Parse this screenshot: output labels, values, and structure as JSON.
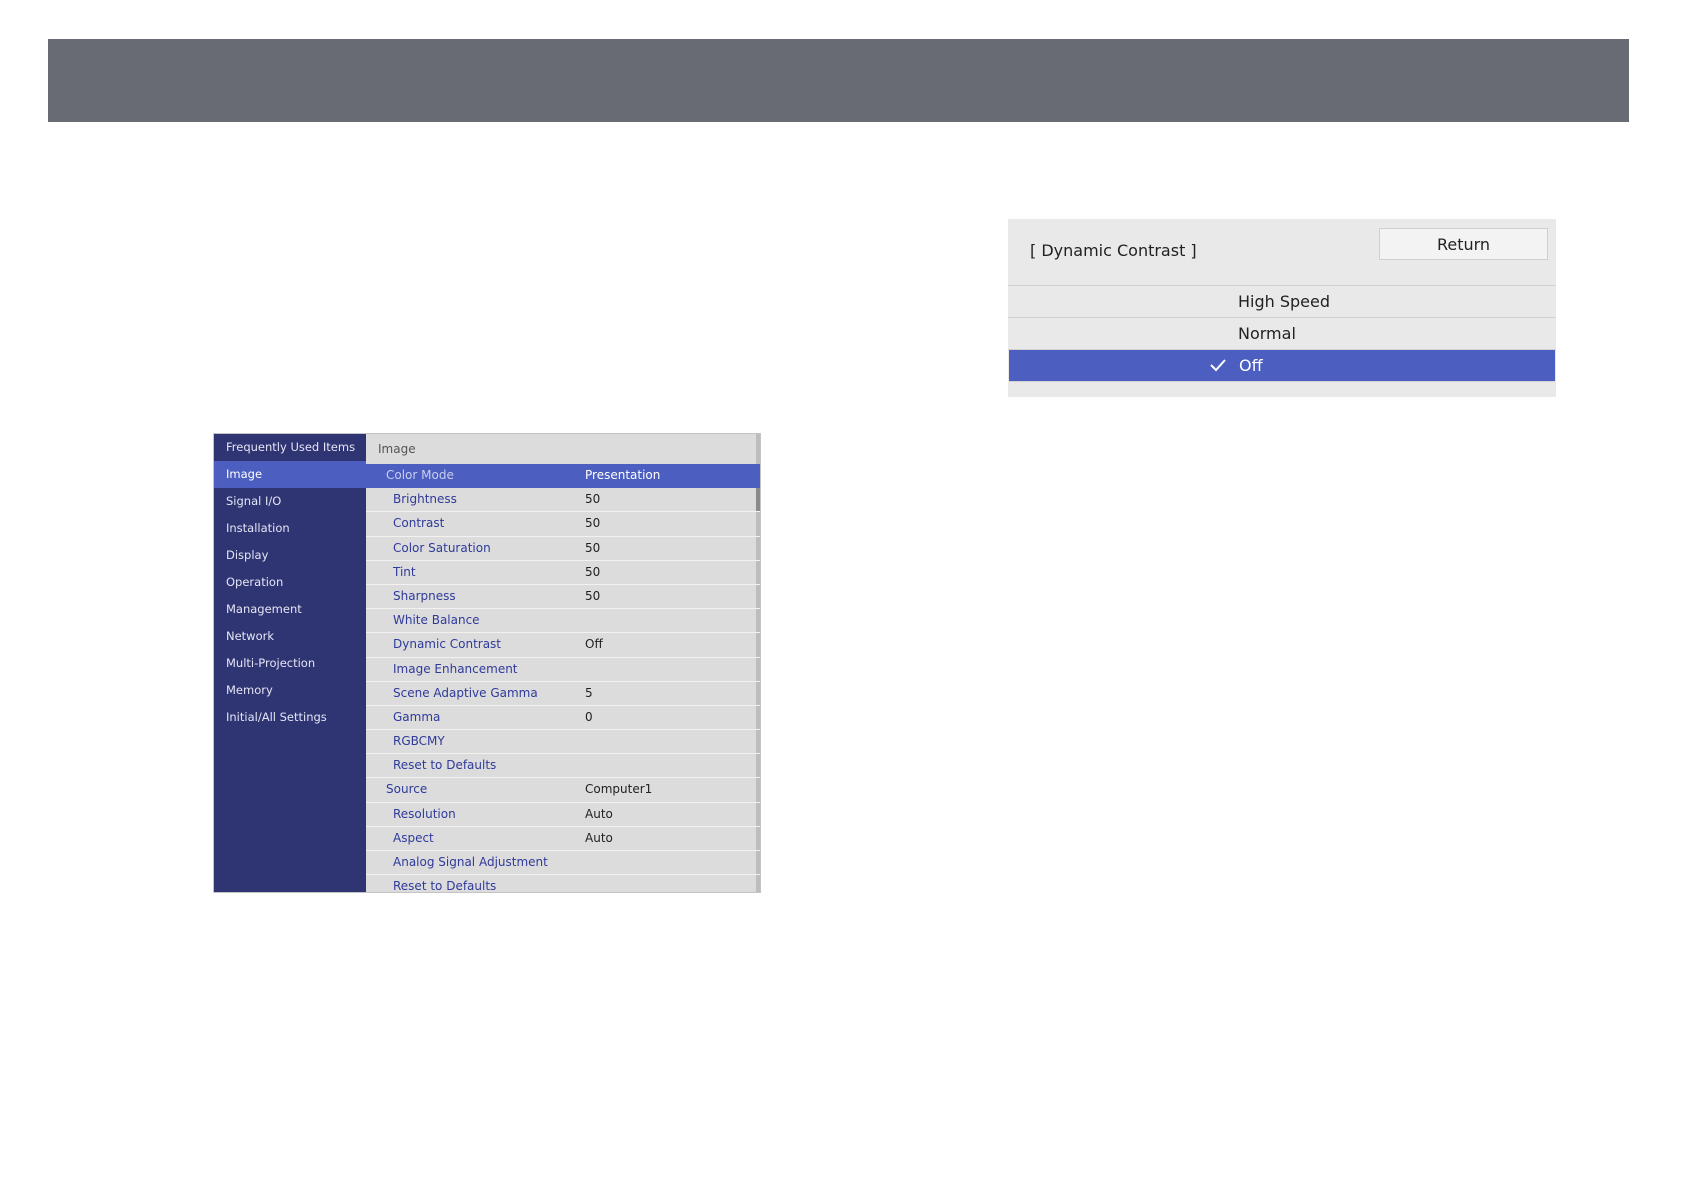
{
  "menu": {
    "sidebar": [
      {
        "label": "Frequently Used Items",
        "active": false
      },
      {
        "label": "Image",
        "active": true
      },
      {
        "label": "Signal I/O",
        "active": false
      },
      {
        "label": "Installation",
        "active": false
      },
      {
        "label": "Display",
        "active": false
      },
      {
        "label": "Operation",
        "active": false
      },
      {
        "label": "Management",
        "active": false
      },
      {
        "label": "Network",
        "active": false
      },
      {
        "label": "Multi-Projection",
        "active": false
      },
      {
        "label": "Memory",
        "active": false
      },
      {
        "label": "Initial/All Settings",
        "active": false
      }
    ],
    "header": "Image",
    "rows": [
      {
        "label": "Color Mode",
        "value": "Presentation",
        "level": "top",
        "selected": true
      },
      {
        "label": "Brightness",
        "value": "50",
        "level": "sub",
        "selected": false
      },
      {
        "label": "Contrast",
        "value": "50",
        "level": "sub",
        "selected": false
      },
      {
        "label": "Color Saturation",
        "value": "50",
        "level": "sub",
        "selected": false
      },
      {
        "label": "Tint",
        "value": "50",
        "level": "sub",
        "selected": false
      },
      {
        "label": "Sharpness",
        "value": "50",
        "level": "sub",
        "selected": false
      },
      {
        "label": "White Balance",
        "value": "",
        "level": "sub",
        "selected": false
      },
      {
        "label": "Dynamic Contrast",
        "value": "Off",
        "level": "sub",
        "selected": false
      },
      {
        "label": "Image Enhancement",
        "value": "",
        "level": "sub",
        "selected": false
      },
      {
        "label": "Scene Adaptive Gamma",
        "value": "5",
        "level": "sub",
        "selected": false
      },
      {
        "label": "Gamma",
        "value": "0",
        "level": "sub",
        "selected": false
      },
      {
        "label": "RGBCMY",
        "value": "",
        "level": "sub",
        "selected": false
      },
      {
        "label": "Reset to Defaults",
        "value": "",
        "level": "sub",
        "selected": false
      },
      {
        "label": "Source",
        "value": "Computer1",
        "level": "top",
        "selected": false
      },
      {
        "label": "Resolution",
        "value": "Auto",
        "level": "sub",
        "selected": false
      },
      {
        "label": "Aspect",
        "value": "Auto",
        "level": "sub",
        "selected": false
      },
      {
        "label": "Analog Signal Adjustment",
        "value": "",
        "level": "sub",
        "selected": false
      },
      {
        "label": "Reset to Defaults",
        "value": "",
        "level": "sub",
        "selected": false
      }
    ]
  },
  "dynamic_contrast": {
    "title": "[ Dynamic Contrast ]",
    "return_label": "Return",
    "options": [
      {
        "label": "High Speed",
        "selected": false
      },
      {
        "label": "Normal",
        "selected": false
      },
      {
        "label": "Off",
        "selected": true
      }
    ]
  },
  "colors": {
    "top_bar": "#686b74",
    "sidebar_bg": "#2f3473",
    "highlight": "#4c5ebf",
    "label_text": "#2f3a9a"
  }
}
